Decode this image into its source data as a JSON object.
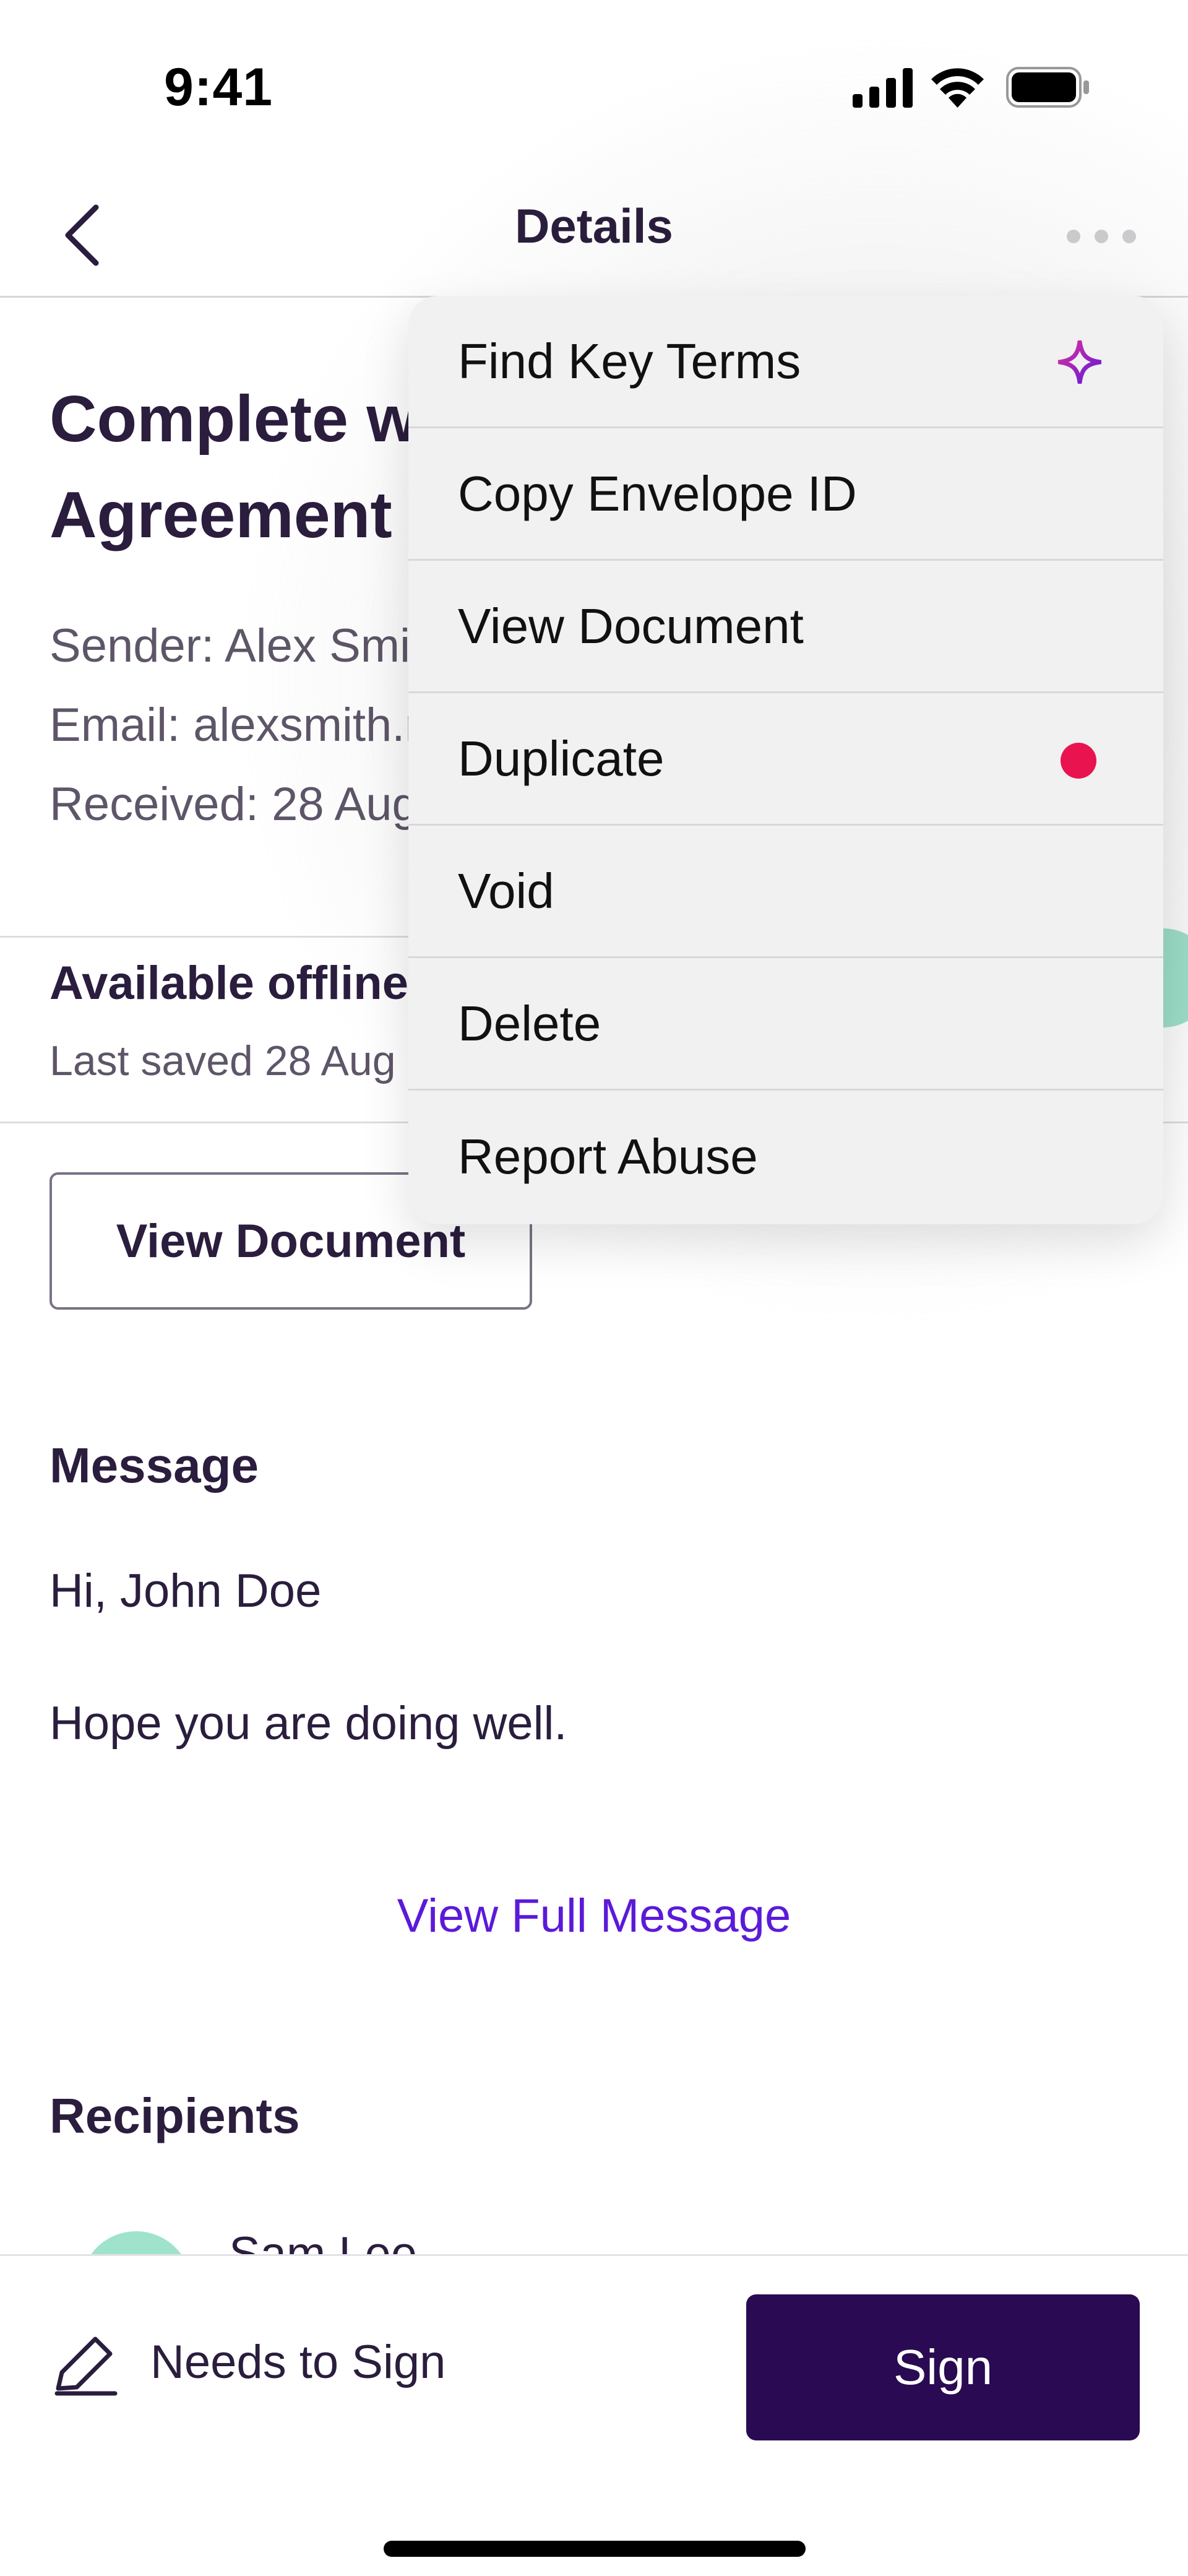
{
  "status_bar": {
    "time": "9:41"
  },
  "nav": {
    "title": "Details"
  },
  "document": {
    "title_line1": "Complete w",
    "title_line2": "Agreement",
    "sender": "Sender: Alex Smi",
    "email": "Email: alexsmith.r",
    "received": "Received: 28 Aug"
  },
  "offline": {
    "title": "Available offline",
    "subtitle": "Last saved 28 Aug"
  },
  "view_document_button": "View Document",
  "message": {
    "heading": "Message",
    "greeting": "Hi, John Doe",
    "body": "Hope you are doing well.",
    "link": "View Full Message"
  },
  "recipients": {
    "heading": "Recipients",
    "first_name": "Sam Lee"
  },
  "bottom_bar": {
    "status": "Needs to Sign",
    "sign_label": "Sign"
  },
  "menu": {
    "items": [
      {
        "label": "Find Key Terms",
        "icon": "sparkle-icon"
      },
      {
        "label": "Copy Envelope ID"
      },
      {
        "label": "View Document"
      },
      {
        "label": "Duplicate",
        "badge_color": "#e8134f"
      },
      {
        "label": "Void"
      },
      {
        "label": "Delete"
      },
      {
        "label": "Report Abuse"
      }
    ]
  },
  "colors": {
    "primary": "#2a0a52",
    "link": "#5b1ad9",
    "accent_green": "#9fe3cc",
    "badge_red": "#e8134f"
  }
}
